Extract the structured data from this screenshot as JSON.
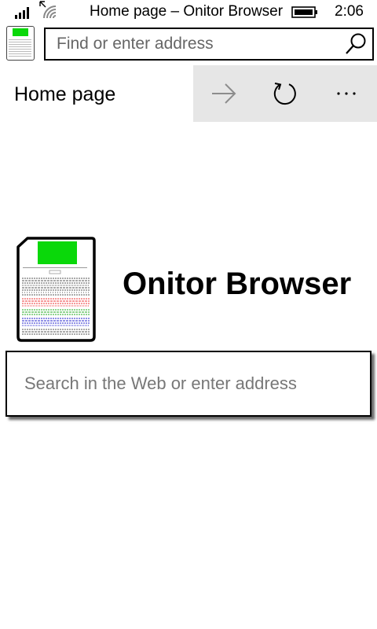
{
  "status_bar": {
    "title": "Home page – Onitor Browser",
    "time": "2:06",
    "icons": {
      "signal": "signal-bars-icon",
      "wifi": "wifi-icon",
      "battery": "battery-icon"
    }
  },
  "address_bar": {
    "placeholder": "Find or enter address",
    "value": "",
    "search_icon": "search-icon"
  },
  "tab_thumbnail": {
    "accent": "#0ad80a"
  },
  "toolbar": {
    "title": "Home page",
    "buttons": {
      "forward": "arrow-right-icon",
      "refresh": "refresh-icon",
      "more": "more-ellipsis-icon"
    },
    "background": "#e6e6e6"
  },
  "home": {
    "brand_name": "Onitor Browser",
    "logo_accent": "#0ad80a",
    "search_placeholder": "Search in the Web or enter address",
    "search_value": ""
  }
}
